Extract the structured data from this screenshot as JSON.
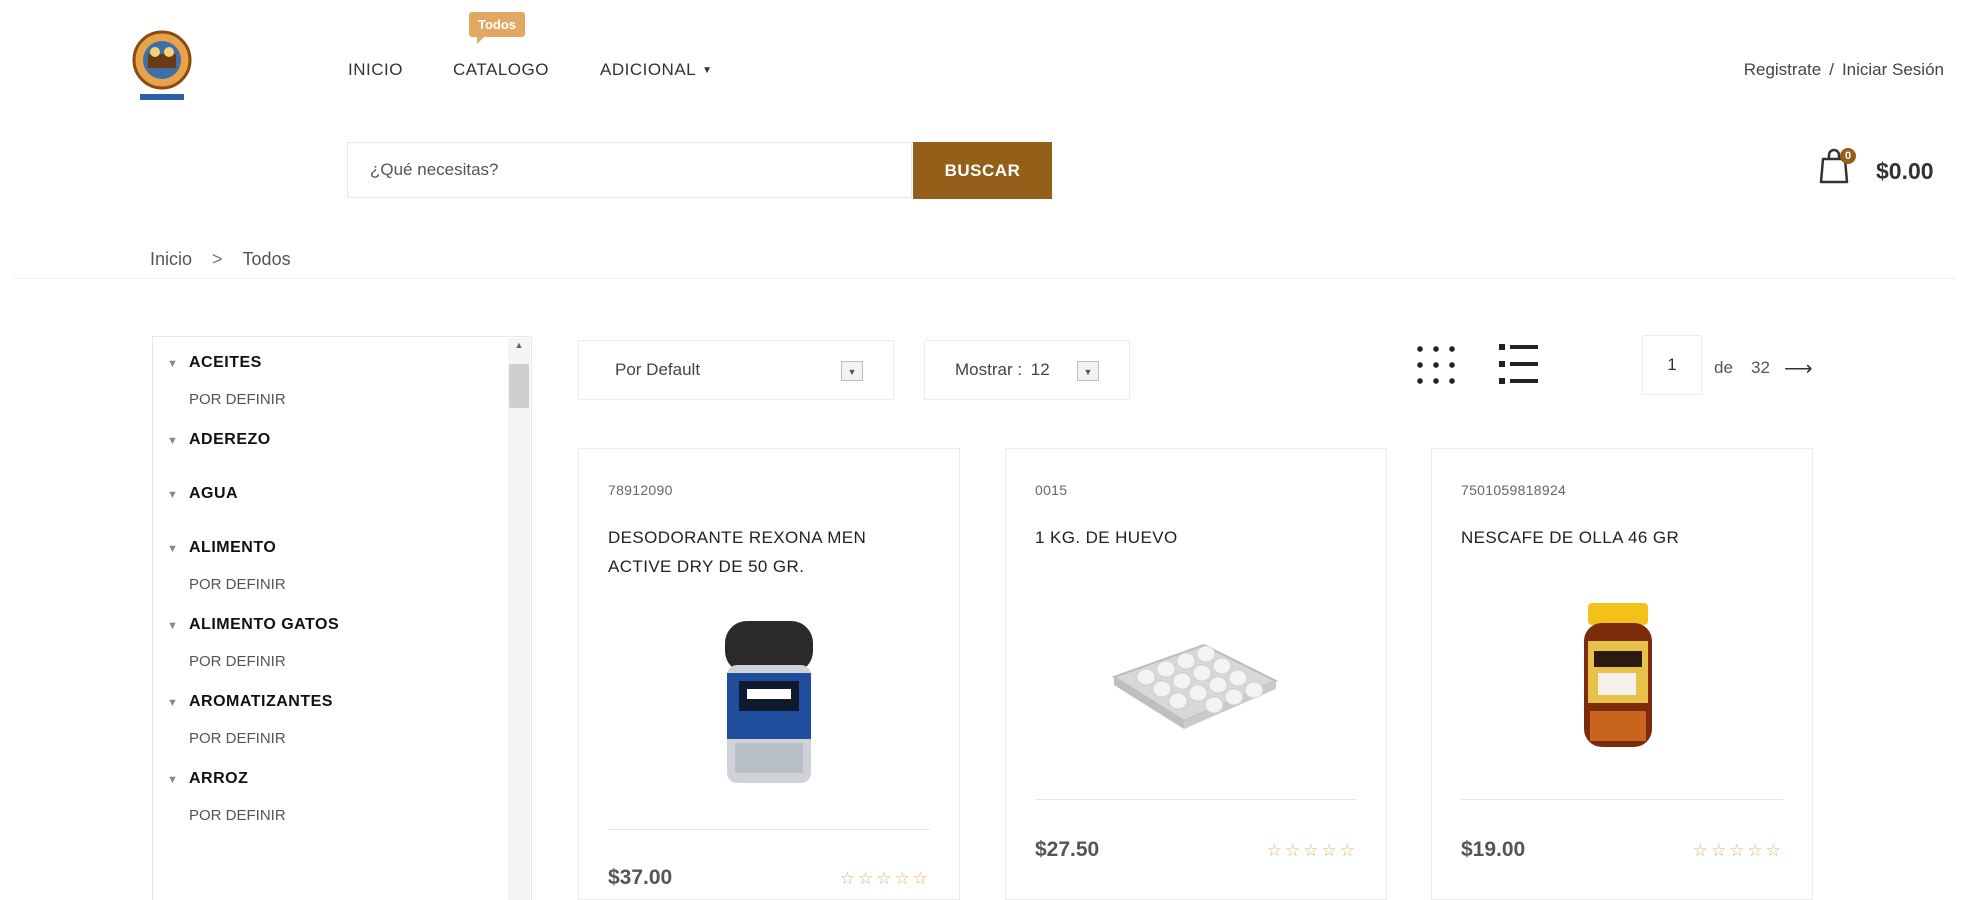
{
  "header": {
    "nav": [
      {
        "label": "INICIO"
      },
      {
        "label": "CATALOGO"
      },
      {
        "label": "ADICIONAL"
      }
    ],
    "catalog_badge": "Todos",
    "auth": {
      "register": "Registrate",
      "separator": "/",
      "login": "Iniciar Sesión"
    },
    "search": {
      "placeholder": "¿Qué necesitas?",
      "value": "",
      "button_label": "BUSCAR"
    },
    "cart": {
      "count": "0",
      "total": "$0.00"
    },
    "logo_icon": "store-logo-icon"
  },
  "breadcrumb": {
    "items": [
      "Inicio",
      "Todos"
    ],
    "separator": ">"
  },
  "sidebar": {
    "categories": [
      {
        "name": "ACEITES",
        "sub": "POR DEFINIR"
      },
      {
        "name": "ADEREZO",
        "sub": ""
      },
      {
        "name": "AGUA",
        "sub": ""
      },
      {
        "name": "ALIMENTO",
        "sub": "POR DEFINIR"
      },
      {
        "name": "ALIMENTO GATOS",
        "sub": "POR DEFINIR"
      },
      {
        "name": "AROMATIZANTES",
        "sub": "POR DEFINIR"
      },
      {
        "name": "ARROZ",
        "sub": "POR DEFINIR"
      }
    ]
  },
  "toolbar": {
    "sort_value": "Por Default",
    "show_label": "Mostrar :",
    "show_value": "12",
    "page_current": "1",
    "page_of": "de",
    "page_total": "32"
  },
  "products": [
    {
      "sku": "78912090",
      "name": "DESODORANTE REXONA MEN ACTIVE DRY DE 50 GR.",
      "price": "$37.00",
      "stars": "☆☆☆☆☆",
      "image_icon": "deodorant-image"
    },
    {
      "sku": "0015",
      "name": "1 KG. DE HUEVO",
      "price": "$27.50",
      "stars": "☆☆☆☆☆",
      "image_icon": "egg-tray-image"
    },
    {
      "sku": "7501059818924",
      "name": "NESCAFE DE OLLA 46 GR",
      "price": "$19.00",
      "stars": "☆☆☆☆☆",
      "image_icon": "coffee-jar-image"
    }
  ],
  "colors": {
    "accent": "#946019",
    "badge": "#e2a862",
    "stars": "#e2b56f"
  }
}
